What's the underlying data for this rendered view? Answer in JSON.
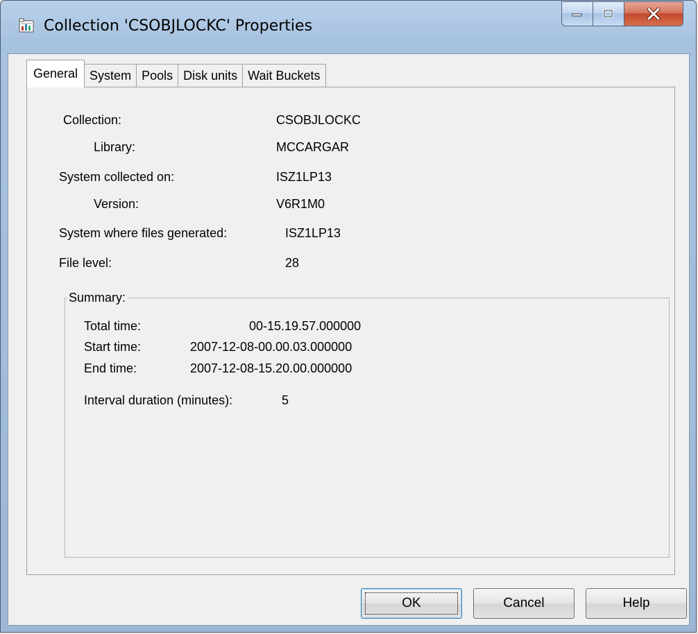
{
  "window": {
    "title": "Collection 'CSOBJLOCKC' Properties"
  },
  "tabs": [
    {
      "label": "General"
    },
    {
      "label": "System"
    },
    {
      "label": "Pools"
    },
    {
      "label": "Disk units"
    },
    {
      "label": "Wait Buckets"
    }
  ],
  "general": {
    "collection_label": "Collection:",
    "collection_value": "CSOBJLOCKC",
    "library_label": "Library:",
    "library_value": "MCCARGAR",
    "system_collected_label": "System collected on:",
    "system_collected_value": "ISZ1LP13",
    "version_label": "Version:",
    "version_value": "V6R1M0",
    "system_generated_label": "System where files generated:",
    "system_generated_value": "ISZ1LP13",
    "file_level_label": "File level:",
    "file_level_value": "28"
  },
  "summary": {
    "label": "Summary:",
    "total_time_label": "Total time:",
    "total_time_value": "00-15.19.57.000000",
    "start_time_label": "Start time:",
    "start_time_value": "2007-12-08-00.00.03.000000",
    "end_time_label": "End time:",
    "end_time_value": "2007-12-08-15.20.00.000000",
    "interval_label": "Interval duration (minutes):",
    "interval_value": "5"
  },
  "buttons": {
    "ok": "OK",
    "cancel": "Cancel",
    "help": "Help"
  },
  "icons": {
    "app": "collection-icon",
    "minimize": "minimize-icon",
    "maximize": "maximize-icon",
    "close": "close-icon"
  },
  "colors": {
    "titlebar": "#b9d1ea",
    "close_button": "#c24a2c",
    "dialog_bg": "#f0f0f0"
  }
}
